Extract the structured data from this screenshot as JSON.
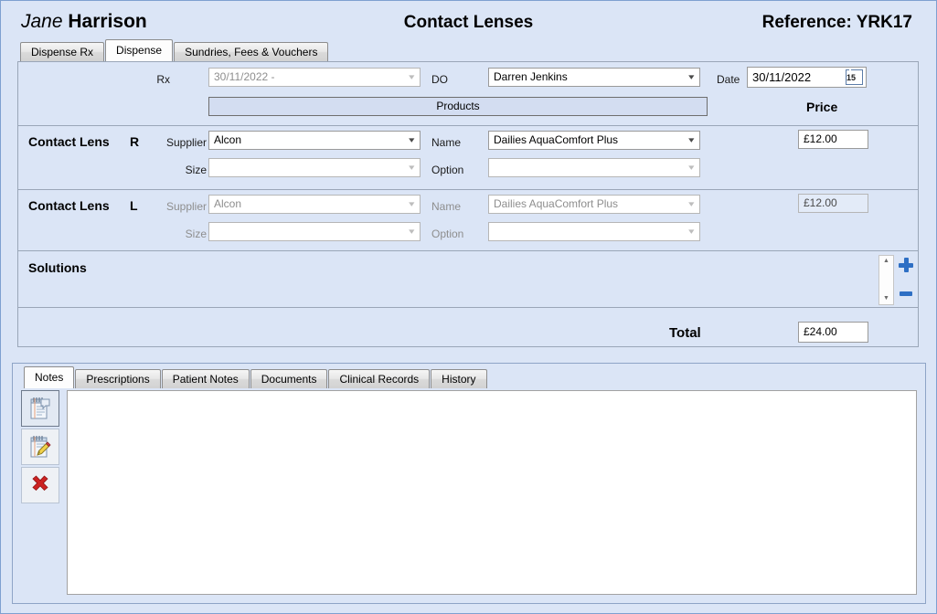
{
  "header": {
    "patient_first_name": "Jane",
    "patient_last_name": "Harrison",
    "screen_title": "Contact Lenses",
    "reference": "Reference: YRK17"
  },
  "top_tabs": [
    {
      "label": "Dispense Rx",
      "active": false
    },
    {
      "label": "Dispense",
      "active": true
    },
    {
      "label": "Sundries, Fees & Vouchers",
      "active": false
    }
  ],
  "dispense": {
    "rx_label": "Rx",
    "rx_value": "30/11/2022 -",
    "do_label": "DO",
    "do_value": "Darren Jenkins",
    "date_label": "Date",
    "date_value": "30/11/2022",
    "calendar_day": "15",
    "products_header": "Products",
    "price_header": "Price",
    "rows": [
      {
        "title": "Contact Lens",
        "eye": "R",
        "supplier_label": "Supplier",
        "supplier_value": "Alcon",
        "size_label": "Size",
        "size_value": "",
        "name_label": "Name",
        "name_value": "Dailies AquaComfort Plus",
        "option_label": "Option",
        "option_value": "",
        "price": "£12.00",
        "disabled": false
      },
      {
        "title": "Contact Lens",
        "eye": "L",
        "supplier_label": "Supplier",
        "supplier_value": "Alcon",
        "size_label": "Size",
        "size_value": "",
        "name_label": "Name",
        "name_value": "Dailies AquaComfort Plus",
        "option_label": "Option",
        "option_value": "",
        "price": "£12.00",
        "disabled": true
      }
    ],
    "solutions_label": "Solutions",
    "total_label": "Total",
    "total_value": "£24.00",
    "add_button": "add-solution",
    "remove_button": "remove-solution"
  },
  "bottom_tabs": [
    {
      "label": "Notes",
      "active": true
    },
    {
      "label": "Prescriptions",
      "active": false
    },
    {
      "label": "Patient Notes",
      "active": false
    },
    {
      "label": "Documents",
      "active": false
    },
    {
      "label": "Clinical Records",
      "active": false
    },
    {
      "label": "History",
      "active": false
    }
  ],
  "notes_tools": [
    {
      "icon": "new-note-icon",
      "selected": true
    },
    {
      "icon": "edit-note-icon",
      "selected": false
    },
    {
      "icon": "delete-note-icon",
      "selected": false
    }
  ],
  "notes_text": "",
  "colors": {
    "panel_background": "#dbe5f6",
    "accent_blue": "#2e6fc4",
    "delete_red": "#cc2222",
    "disabled_text": "#8e8e8e"
  }
}
